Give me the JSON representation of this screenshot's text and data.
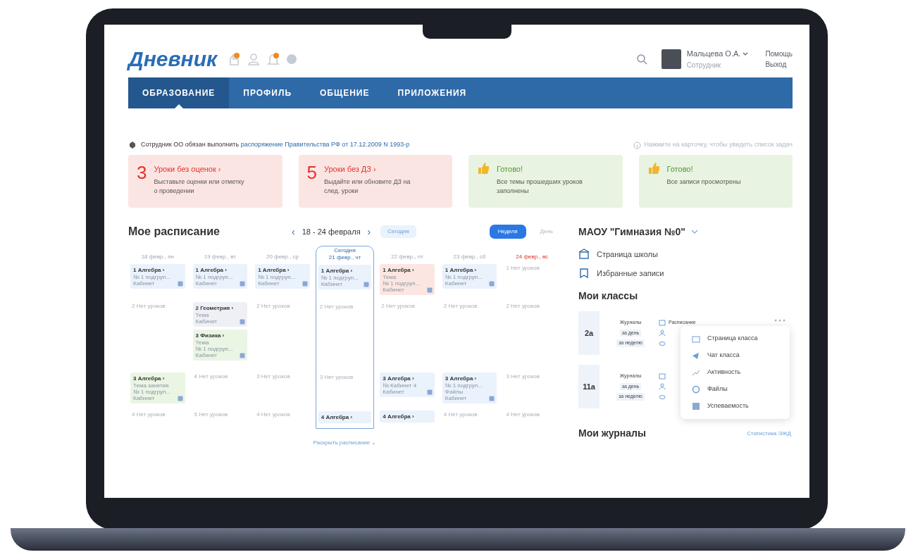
{
  "header": {
    "logo": "Дневник",
    "user_name": "Мальцева О.А.",
    "user_role": "Сотрудник",
    "links": [
      "Помощь",
      "Выход"
    ]
  },
  "nav": [
    {
      "label": "ОБРАЗОВАНИЕ",
      "selected": true
    },
    {
      "label": "ПРОФИЛЬ",
      "selected": false
    },
    {
      "label": "ОБЩЕНИЕ",
      "selected": false
    },
    {
      "label": "ПРИЛОЖЕНИЯ",
      "selected": false
    }
  ],
  "notice": {
    "text": "Сотрудник ОО обязан выполнить",
    "link": "распоряжение Правительства РФ от 17.12.2009 N 1993-р",
    "hint": "Нажмите на карточку, чтобы увидеть список задач"
  },
  "cards": [
    {
      "kind": "count",
      "count": "3",
      "title": "Уроки без оценок ›",
      "text": "Выставьте оценки или отметку о проведении"
    },
    {
      "kind": "count",
      "count": "5",
      "title": "Уроки без ДЗ ›",
      "text": "Выдайте или обновите ДЗ на след. уроки"
    },
    {
      "kind": "done",
      "title": "Готово!",
      "text": "Все темы прошедших уроков заполнены"
    },
    {
      "kind": "done",
      "title": "Готово!",
      "text": "Все записи просмотрены"
    }
  ],
  "schedule": {
    "title": "Мое расписание",
    "prev": "‹",
    "range": "18 - 24 февраля",
    "next": "›",
    "today_button": "Сегодня",
    "views": [
      {
        "label": "Неделя",
        "selected": true
      },
      {
        "label": "День",
        "selected": false
      }
    ],
    "days": [
      {
        "label": "18 февр., пн",
        "today": false,
        "weekend": false,
        "slots": [
          [
            {
              "kind": "lesson",
              "color": "#eaf2fc",
              "title": "1 Алгебра ›",
              "lines": [
                "№ 1 подгруп...",
                "Кабинет"
              ]
            }
          ],
          [
            {
              "kind": "empty",
              "text": "2 Нет уроков"
            }
          ],
          [
            {
              "kind": "lesson",
              "color": "#eaf5e4",
              "title": "3 Алгебра ›",
              "lines": [
                "Тема занятия",
                "№ 1 подгруп...",
                "Кабинет"
              ]
            }
          ],
          [
            {
              "kind": "empty",
              "text": "4 Нет уроков"
            }
          ]
        ]
      },
      {
        "label": "19 февр., вт",
        "today": false,
        "weekend": false,
        "slots": [
          [
            {
              "kind": "lesson",
              "color": "#eaf2fc",
              "title": "1 Алгебра ›",
              "lines": [
                "№ 1 подгруп...",
                "Кабинет"
              ]
            }
          ],
          [
            {
              "kind": "lesson",
              "color": "#eef0f5",
              "title": "2 Геометрия ›",
              "lines": [
                "Тема",
                "Кабинет"
              ]
            },
            {
              "kind": "lesson",
              "color": "#eaf5e4",
              "title": "3 Физика ›",
              "lines": [
                "Тема",
                "№ 1 подгруп...",
                "Кабинет"
              ]
            }
          ],
          [
            {
              "kind": "empty",
              "text": "4 Нет уроков"
            }
          ],
          [
            {
              "kind": "empty",
              "text": "5 Нет уроков"
            }
          ]
        ]
      },
      {
        "label": "20 февр., ср",
        "today": false,
        "weekend": false,
        "slots": [
          [
            {
              "kind": "lesson",
              "color": "#eaf2fc",
              "title": "1 Алгебра ›",
              "lines": [
                "№ 1 подгруп...",
                "Кабинет"
              ]
            }
          ],
          [
            {
              "kind": "empty",
              "text": "2 Нет уроков"
            }
          ],
          [
            {
              "kind": "empty",
              "text": "3 Нет уроков"
            }
          ],
          [
            {
              "kind": "empty",
              "text": "4 Нет уроков"
            }
          ]
        ]
      },
      {
        "label": "21 февр., чт",
        "today": true,
        "today_label": "Сегодня",
        "weekend": false,
        "slots": [
          [
            {
              "kind": "lesson",
              "color": "#eaf2fc",
              "title": "1 Алгебра ›",
              "lines": [
                "№ 1 подгруп...",
                "Кабинет"
              ]
            }
          ],
          [
            {
              "kind": "empty",
              "text": "2 Нет уроков"
            }
          ],
          [
            {
              "kind": "empty",
              "text": "3 Нет уроков"
            }
          ],
          [
            {
              "kind": "lesson",
              "color": "#eaf2fc",
              "title": "4 Алгебра ›"
            }
          ]
        ]
      },
      {
        "label": "22 февр., пт",
        "today": false,
        "weekend": false,
        "slots": [
          [
            {
              "kind": "lesson",
              "color": "#fbe6e1",
              "title": "1 Алгебра ›",
              "lines": [
                "Тема",
                "№ 1 подгруп...",
                "Кабинет"
              ]
            }
          ],
          [
            {
              "kind": "empty",
              "text": "2 Нет уроков"
            }
          ],
          [
            {
              "kind": "lesson",
              "color": "#eaf2fc",
              "title": "3 Алгебра ›",
              "lines": [
                "№ Кабинет 4",
                "Кабинет"
              ]
            }
          ],
          [
            {
              "kind": "lesson",
              "color": "#eaf2fc",
              "title": "4 Алгебра ›"
            }
          ]
        ]
      },
      {
        "label": "23 февр., сб",
        "today": false,
        "weekend": false,
        "slots": [
          [
            {
              "kind": "lesson",
              "color": "#eaf2fc",
              "title": "1 Алгебра ›",
              "lines": [
                "№ 1 подгруп...",
                "Кабинет"
              ]
            }
          ],
          [
            {
              "kind": "empty",
              "text": "2 Нет уроков"
            }
          ],
          [
            {
              "kind": "lesson",
              "color": "#eaf2fc",
              "title": "3 Алгебра ›",
              "lines": [
                "№ 1 подгруп...",
                "Файлы",
                "Кабинет"
              ]
            }
          ],
          [
            {
              "kind": "empty",
              "text": "4 Нет уроков"
            }
          ]
        ]
      },
      {
        "label": "24 февр., вс",
        "today": false,
        "weekend": true,
        "slots": [
          [
            {
              "kind": "empty",
              "text": "1 Нет уроков"
            }
          ],
          [
            {
              "kind": "empty",
              "text": "2 Нет уроков"
            }
          ],
          [
            {
              "kind": "empty",
              "text": "3 Нет уроков"
            }
          ],
          [
            {
              "kind": "empty",
              "text": "4 Нет уроков"
            }
          ]
        ]
      }
    ],
    "expand": "Раскрыть расписание ⌄"
  },
  "side": {
    "school": "МАОУ \"Гимназия №0\"",
    "links": [
      "Страница школы",
      "Избранные записи"
    ],
    "classes_title": "Мои классы",
    "classes": [
      {
        "name": "2а",
        "journal": "Журналы",
        "day": "за день",
        "week": "за неделю",
        "schedule": "Расписание"
      },
      {
        "name": "11а",
        "journal": "Журналы",
        "day": "за день",
        "week": "за неделю"
      }
    ],
    "menu": [
      "Страница класса",
      "Чат класса",
      "Активность",
      "Файлы",
      "Успеваемость"
    ],
    "journals_title": "Мои журналы",
    "stats_link": "Статистика ЭЖД"
  }
}
